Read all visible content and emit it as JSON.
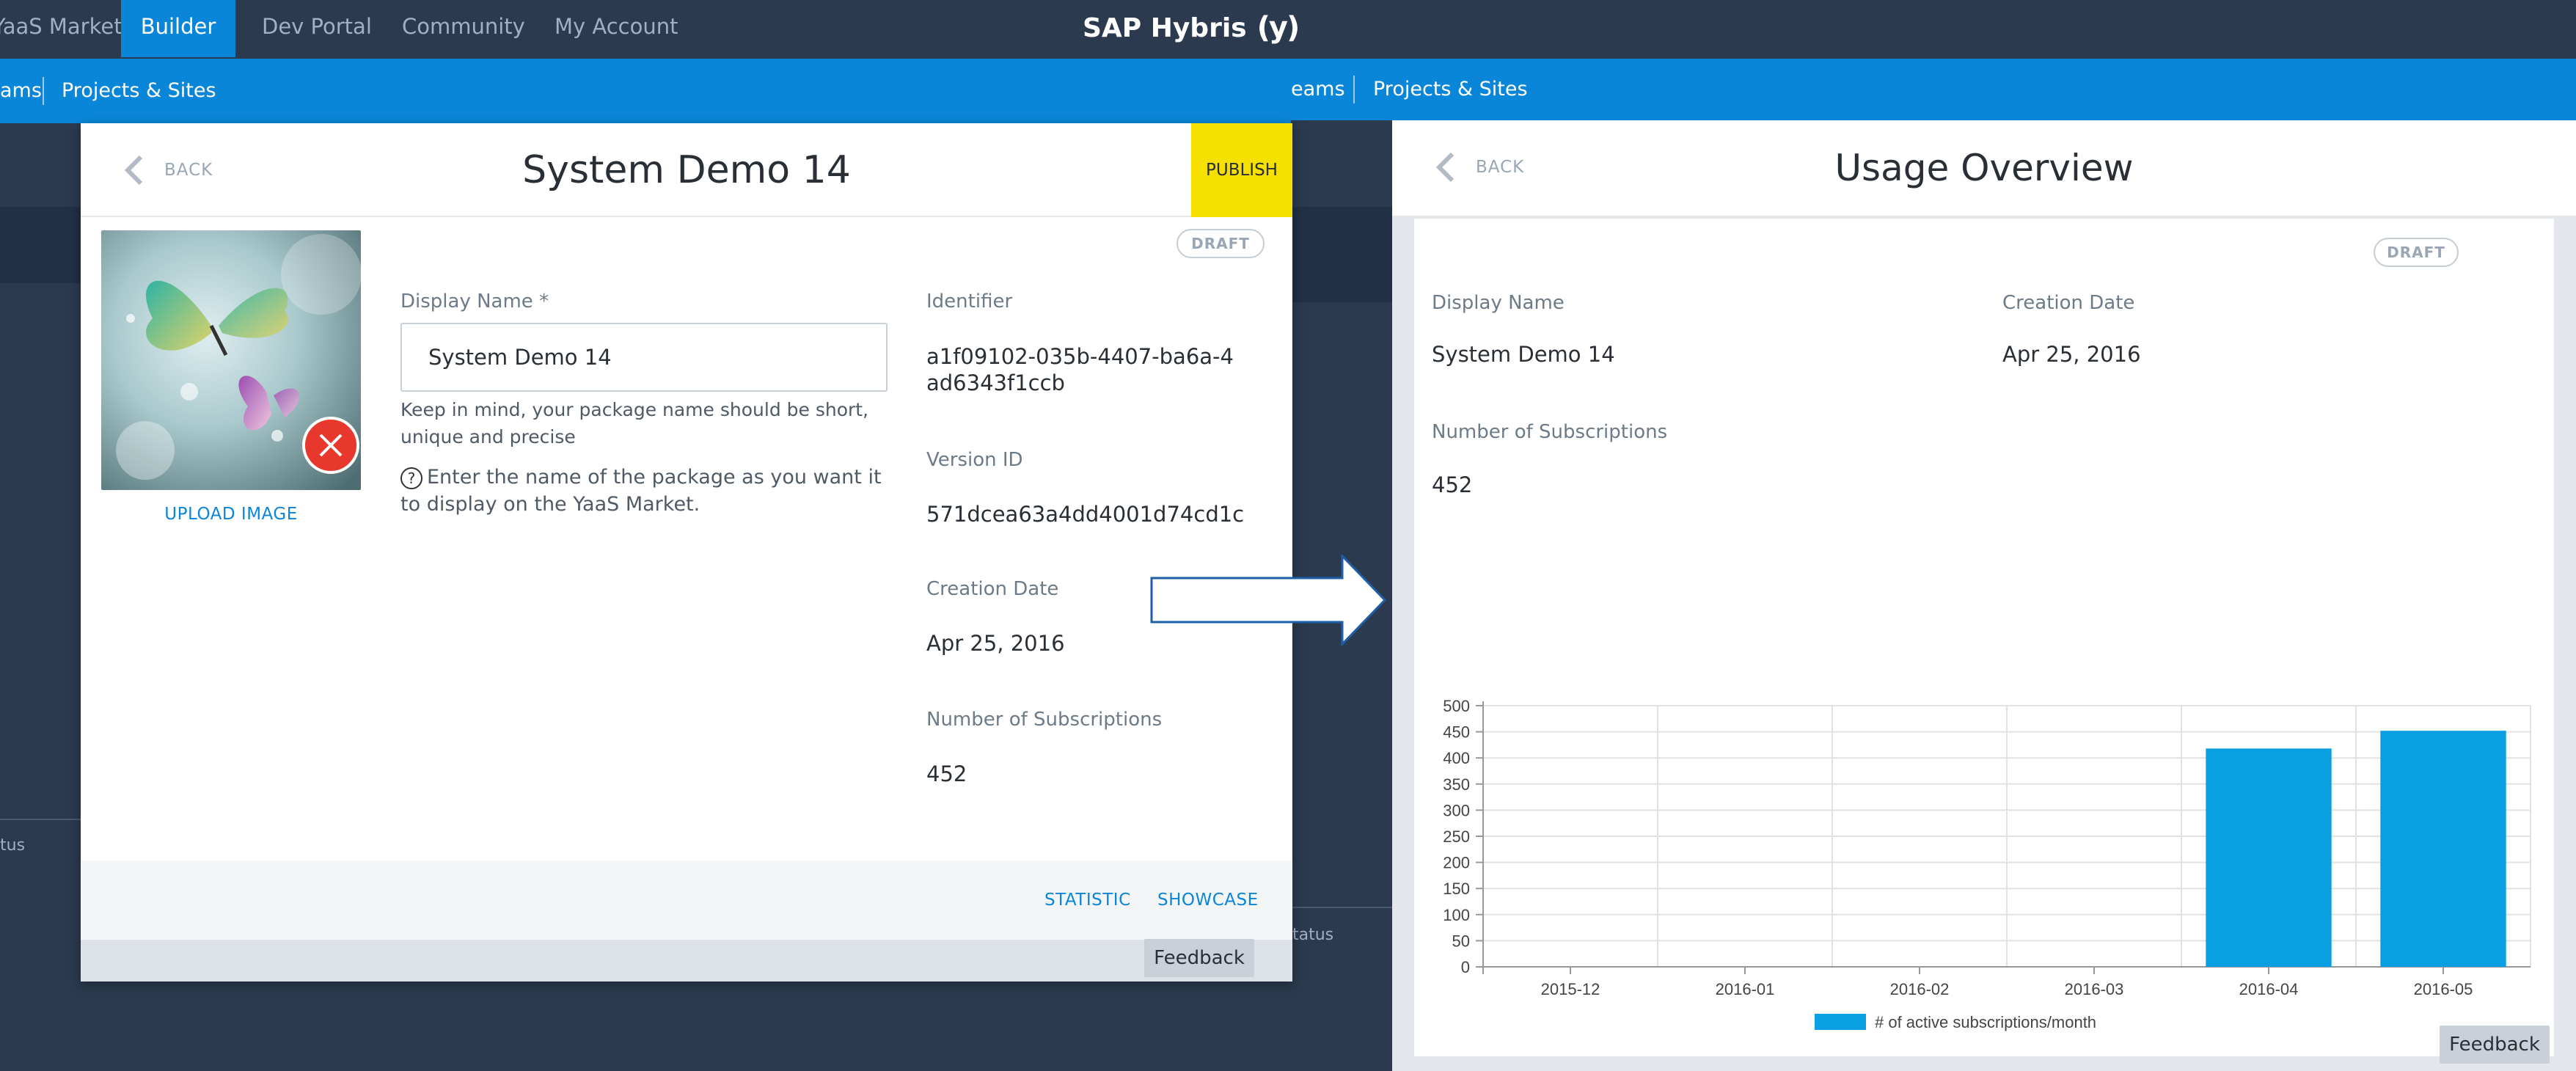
{
  "topnav": {
    "items": [
      {
        "label": "YaaS Market",
        "active": false
      },
      {
        "label": "Builder",
        "active": true
      },
      {
        "label": "Dev Portal",
        "active": false
      },
      {
        "label": "Community",
        "active": false
      },
      {
        "label": "My Account",
        "active": false
      }
    ],
    "brand": "SAP Hybris",
    "brand_logo": "(y)"
  },
  "subbar_left": {
    "teams_fragment": "ams",
    "projects": "Projects & Sites"
  },
  "subbar_right": {
    "teams_fragment": "eams",
    "projects": "Projects & Sites"
  },
  "background": {
    "status_left": "tus",
    "status_right": "tatus"
  },
  "editor": {
    "back_label": "BACK",
    "title": "System Demo 14",
    "publish_label": "PUBLISH",
    "draft_badge": "DRAFT",
    "upload_label": "UPLOAD IMAGE",
    "display_name_label": "Display Name *",
    "display_name_value": "System Demo 14",
    "hint_short": "Keep in mind, your package name should be short, unique and precise",
    "hint_help": "Enter the name of the package as you want it to display on the YaaS Market.",
    "identifier_label": "Identifier",
    "identifier_value": "a1f09102-035b-4407-ba6a-4ad6343f1ccb",
    "version_label": "Version ID",
    "version_value": "571dcea63a4dd4001d74cd1c",
    "creation_label": "Creation Date",
    "creation_value": "Apr 25, 2016",
    "subs_label": "Number of Subscriptions",
    "subs_value": "452",
    "statistic_label": "STATISTIC",
    "showcase_label": "SHOWCASE",
    "feedback_label": "Feedback"
  },
  "overview": {
    "back_label": "BACK",
    "title": "Usage Overview",
    "draft_badge": "DRAFT",
    "display_name_label": "Display Name",
    "display_name_value": "System Demo 14",
    "creation_label": "Creation Date",
    "creation_value": "Apr 25, 2016",
    "subs_label": "Number of Subscriptions",
    "subs_value": "452",
    "feedback_label": "Feedback"
  },
  "colors": {
    "accent": "#0a86d8",
    "bar": "#0a9fe3",
    "publish": "#f6e000",
    "delete": "#e8372c"
  },
  "chart_data": {
    "type": "bar",
    "categories": [
      "2015-12",
      "2016-01",
      "2016-02",
      "2016-03",
      "2016-04",
      "2016-05"
    ],
    "series": [
      {
        "name": "# of active subscriptions/month",
        "values": [
          0,
          0,
          0,
          0,
          418,
          452
        ]
      }
    ],
    "yticks": [
      "0",
      "50",
      "100",
      "150",
      "200",
      "250",
      "300",
      "350",
      "400",
      "450",
      "500"
    ],
    "ylim": [
      0,
      500
    ],
    "grid": true,
    "legend_position": "bottom"
  }
}
